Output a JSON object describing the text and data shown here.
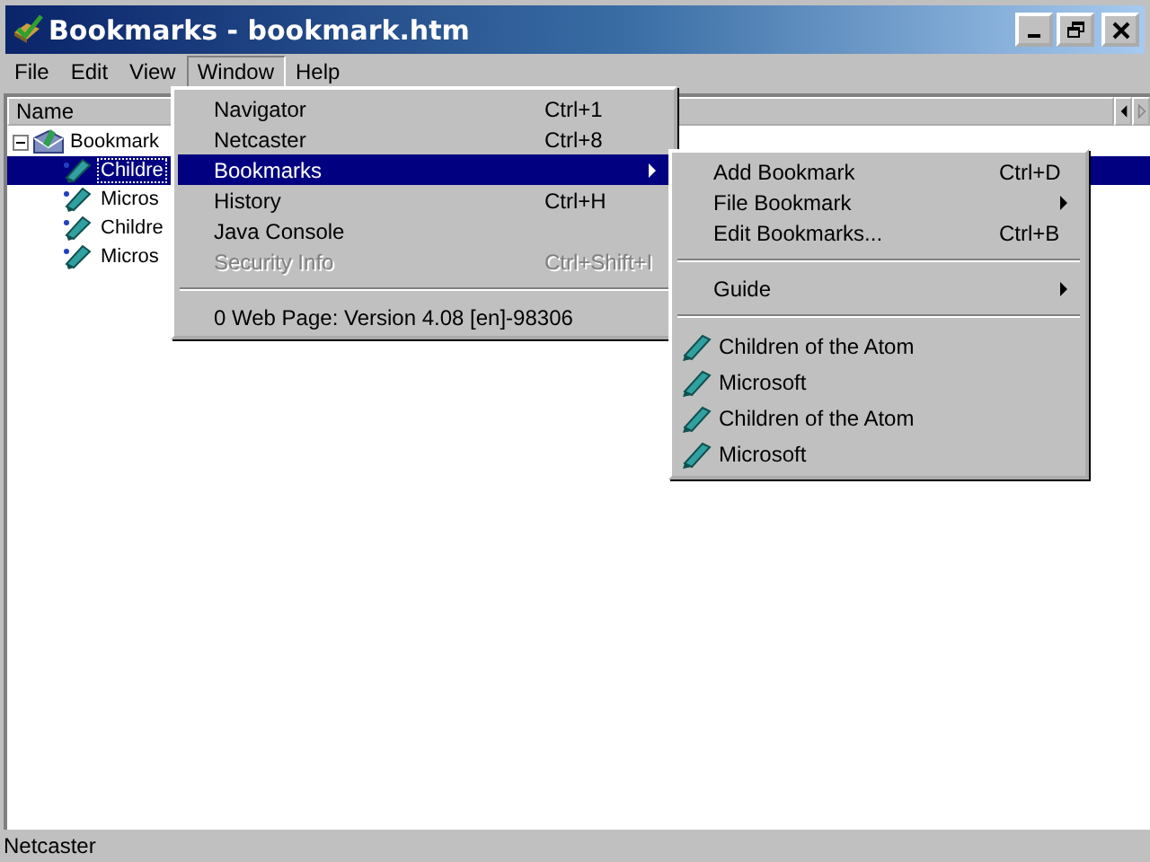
{
  "window": {
    "title": "Bookmarks - bookmark.htm"
  },
  "menu_bar": [
    {
      "label": "File",
      "selected": false
    },
    {
      "label": "Edit",
      "selected": false
    },
    {
      "label": "View",
      "selected": false
    },
    {
      "label": "Window",
      "selected": true
    },
    {
      "label": "Help",
      "selected": false
    }
  ],
  "list": {
    "columns": [
      "Name"
    ],
    "tree": [
      {
        "label": "Bookmark",
        "expanded": true,
        "selected": false,
        "children": [
          {
            "label": "Childre",
            "selected": true
          },
          {
            "label": "Micros",
            "selected": false
          },
          {
            "label": "Childre",
            "selected": false
          },
          {
            "label": "Micros",
            "selected": false
          }
        ]
      }
    ]
  },
  "window_menu": [
    {
      "kind": "item",
      "label": "Navigator",
      "shortcut": "Ctrl+1",
      "selected": false,
      "disabled": false,
      "submenu": false
    },
    {
      "kind": "item",
      "label": "Netcaster",
      "shortcut": "Ctrl+8",
      "selected": false,
      "disabled": false,
      "submenu": false
    },
    {
      "kind": "item",
      "label": "Bookmarks",
      "selected": true,
      "disabled": false,
      "submenu": true
    },
    {
      "kind": "item",
      "label": "History",
      "shortcut": "Ctrl+H",
      "selected": false,
      "disabled": false,
      "submenu": false
    },
    {
      "kind": "item",
      "label": "Java Console",
      "selected": false,
      "disabled": false,
      "submenu": false
    },
    {
      "kind": "item",
      "label": "Security Info",
      "shortcut": "Ctrl+Shift+I",
      "selected": false,
      "disabled": true,
      "submenu": false
    },
    {
      "kind": "separator"
    },
    {
      "kind": "item",
      "label": "0 Web Page: Version 4.08 [en]-98306",
      "selected": false,
      "disabled": false,
      "submenu": false
    }
  ],
  "bookmarks_menu": [
    {
      "kind": "item",
      "label": "Add Bookmark",
      "shortcut": "Ctrl+D",
      "submenu": false
    },
    {
      "kind": "item",
      "label": "File Bookmark",
      "submenu": true
    },
    {
      "kind": "item",
      "label": "Edit Bookmarks...",
      "shortcut": "Ctrl+B",
      "submenu": false
    },
    {
      "kind": "separator"
    },
    {
      "kind": "item",
      "label": "Guide",
      "submenu": true
    },
    {
      "kind": "separator"
    },
    {
      "kind": "bookmark",
      "label": "Children of the Atom"
    },
    {
      "kind": "bookmark",
      "label": "Microsoft"
    },
    {
      "kind": "bookmark",
      "label": "Children of the Atom"
    },
    {
      "kind": "bookmark",
      "label": "Microsoft"
    }
  ],
  "status_bar": {
    "text": "Netcaster"
  }
}
